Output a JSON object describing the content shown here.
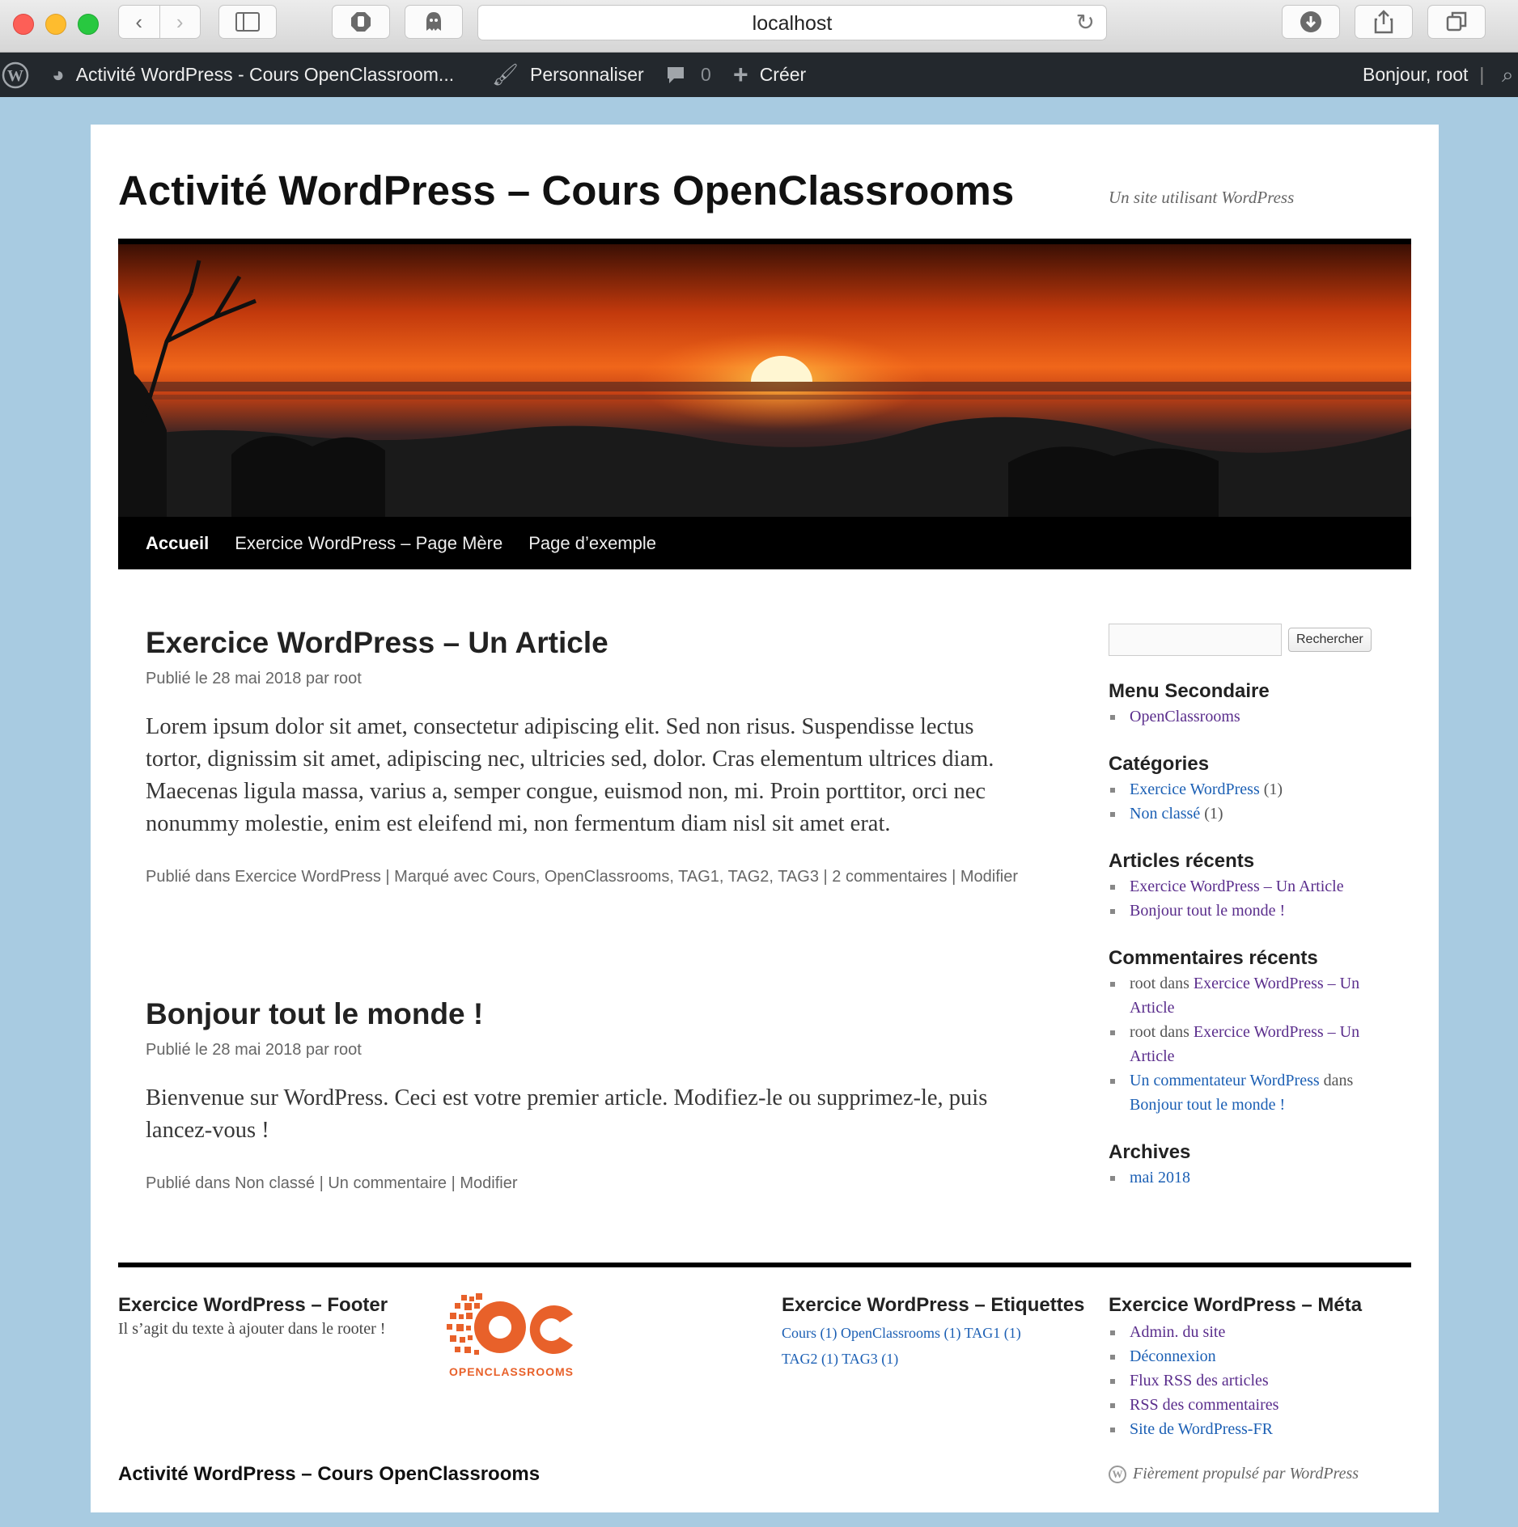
{
  "browser": {
    "url": "localhost",
    "back_icon": "chevron-left",
    "forward_icon": "chevron-right"
  },
  "adminbar": {
    "site_name": "Activité WordPress - Cours OpenClassroom...",
    "customize": "Personnaliser",
    "comments_count": "0",
    "new_label": "Créer",
    "greeting": "Bonjour, root"
  },
  "site": {
    "title": "Activité WordPress – Cours OpenClassrooms",
    "description": "Un site utilisant WordPress"
  },
  "nav": [
    "Accueil",
    "Exercice WordPress – Page Mère",
    "Page d’exemple"
  ],
  "posts": [
    {
      "title": "Exercice WordPress – Un Article",
      "meta_prefix": "Publié le ",
      "date": "28 mai 2018",
      "by": " par ",
      "author": "root",
      "content": "Lorem ipsum dolor sit amet, consectetur adipiscing elit. Sed non risus. Suspendisse lectus tortor, dignissim sit amet, adipiscing nec, ultricies sed, dolor. Cras elementum ultrices diam. Maecenas ligula massa, varius a, semper congue, euismod non, mi. Proin porttitor, orci nec nonummy molestie, enim est eleifend mi, non fermentum diam nisl sit amet erat.",
      "posted_in": "Publié dans ",
      "category": "Exercice WordPress",
      "tagged": " | Marqué avec ",
      "tags": [
        "Cours",
        "OpenClassrooms",
        "TAG1",
        "TAG2",
        "TAG3"
      ],
      "comments": "2 commentaires",
      "edit": "Modifier"
    },
    {
      "title": "Bonjour tout le monde !",
      "meta_prefix": "Publié le ",
      "date": "28 mai 2018",
      "by": " par ",
      "author": "root",
      "content": "Bienvenue sur WordPress. Ceci est votre premier article. Modifiez-le ou supprimez-le, puis lancez-vous !",
      "posted_in": "Publié dans ",
      "category": "Non classé",
      "comments": "Un commentaire",
      "edit": "Modifier"
    }
  ],
  "sidebar": {
    "search_button": "Rechercher",
    "menu": {
      "title": "Menu Secondaire",
      "items": [
        "OpenClassrooms"
      ]
    },
    "categories": {
      "title": "Catégories",
      "items": [
        {
          "name": "Exercice WordPress",
          "count": " (1)"
        },
        {
          "name": "Non classé",
          "count": " (1)"
        }
      ]
    },
    "recent_posts": {
      "title": "Articles récents",
      "items": [
        "Exercice WordPress – Un Article",
        "Bonjour tout le monde !"
      ]
    },
    "recent_comments": {
      "title": "Commentaires récents",
      "items": [
        {
          "author": "root",
          "in": " dans ",
          "post": "Exercice WordPress – Un Article"
        },
        {
          "author": "root",
          "in": " dans ",
          "post": "Exercice WordPress – Un Article"
        },
        {
          "author": "Un commentateur WordPress",
          "in": " dans ",
          "post": "Bonjour tout le monde !"
        }
      ]
    },
    "archives": {
      "title": "Archives",
      "items": [
        "mai 2018"
      ]
    }
  },
  "footer": {
    "text_widget": {
      "title": "Exercice WordPress – Footer",
      "text": "Il s’agit du texte à ajouter dans le rooter !"
    },
    "logo_text": "OPENCLASSROOMS",
    "tags_widget": {
      "title": "Exercice WordPress – Etiquettes",
      "tags": [
        "Cours (1)",
        "OpenClassrooms (1)",
        "TAG1 (1)",
        "TAG2 (1)",
        "TAG3 (1)"
      ]
    },
    "meta_widget": {
      "title": "Exercice WordPress – Méta",
      "items": [
        "Admin. du site",
        "Déconnexion",
        "Flux RSS des articles",
        "RSS des commentaires",
        "Site de WordPress-FR"
      ]
    },
    "site_title": "Activité WordPress – Cours OpenClassrooms",
    "powered": "Fièrement propulsé par WordPress"
  },
  "colors": {
    "page_bg": "#a8cbe1",
    "adminbar": "#23282d",
    "link_purple": "#5a2d8c",
    "link_blue": "#1b5fb4",
    "logo_orange": "#e8612a"
  }
}
